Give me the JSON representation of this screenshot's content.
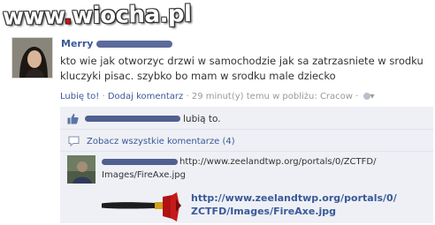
{
  "watermark": {
    "text_before": "www",
    "dot": ".",
    "text_after": "wiocha.pl"
  },
  "post": {
    "author": "Merry",
    "text": "kto wie jak otworzyc drzwi w samochodzie jak sa zatrzasniete w srodku kluczyki pisac. szybko bo mam w srodku male dziecko",
    "like_label": "Lubię to!",
    "separator": "·",
    "comment_label": "Dodaj komentarz",
    "timestamp": "29 minut(y) temu w pobliżu: Cracow",
    "globe_arrow": "▾"
  },
  "feedback": {
    "likes_suffix": "lubią to.",
    "view_all": "Zobacz wszystkie komentarze (4)"
  },
  "comment": {
    "text_line1": "http://www.zeelandtwp.org/portals/0/ZCTFD/",
    "text_line2": "Images/FireAxe.jpg",
    "attachment_line1": "http://www.zeelandtwp.org/portals/0/",
    "attachment_line2": "ZCTFD/Images/FireAxe.jpg"
  },
  "colors": {
    "link": "#3b5998",
    "meta": "#999999",
    "ufi_bg": "#eef0f5",
    "watermark_dot": "#d41010"
  }
}
